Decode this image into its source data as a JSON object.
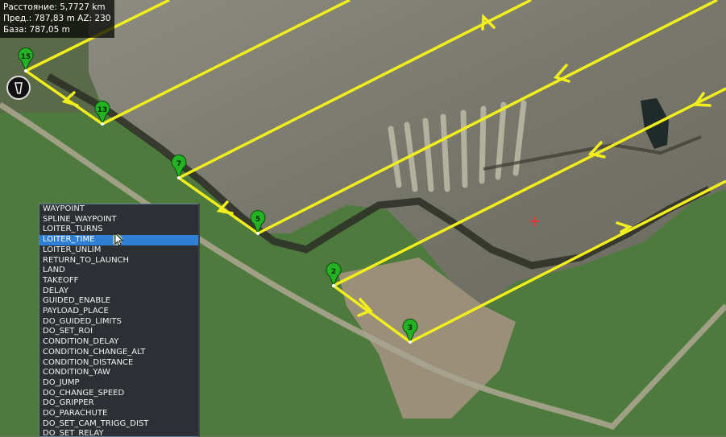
{
  "info": {
    "distance": "Расстояние: 5,7727 km",
    "prev": "Пред.: 787,83 m AZ: 230",
    "base": "База: 787,05 m"
  },
  "waypoints": [
    {
      "label": "15"
    },
    {
      "label": "13"
    },
    {
      "label": "7"
    },
    {
      "label": "5"
    },
    {
      "label": "2"
    },
    {
      "label": "3"
    }
  ],
  "command_menu": {
    "items": [
      "WAYPOINT",
      "SPLINE_WAYPOINT",
      "LOITER_TURNS",
      "LOITER_TIME",
      "LOITER_UNLIM",
      "RETURN_TO_LAUNCH",
      "LAND",
      "TAKEOFF",
      "DELAY",
      "GUIDED_ENABLE",
      "PAYLOAD_PLACE",
      "DO_GUIDED_LIMITS",
      "DO_SET_ROI",
      "CONDITION_DELAY",
      "CONDITION_CHANGE_ALT",
      "CONDITION_DISTANCE",
      "CONDITION_YAW",
      "DO_JUMP",
      "DO_CHANGE_SPEED",
      "DO_GRIPPER",
      "DO_PARACHUTE",
      "DO_SET_CAM_TRIGG_DIST",
      "DO_SET_RELAY"
    ],
    "selected": "LOITER_TIME"
  },
  "colors": {
    "route": "#f2ee1c",
    "marker": "#22b222",
    "menu_bg": "#2c2f33",
    "menu_selected": "#2f7fd4",
    "home_cross": "#ff2a2a"
  }
}
